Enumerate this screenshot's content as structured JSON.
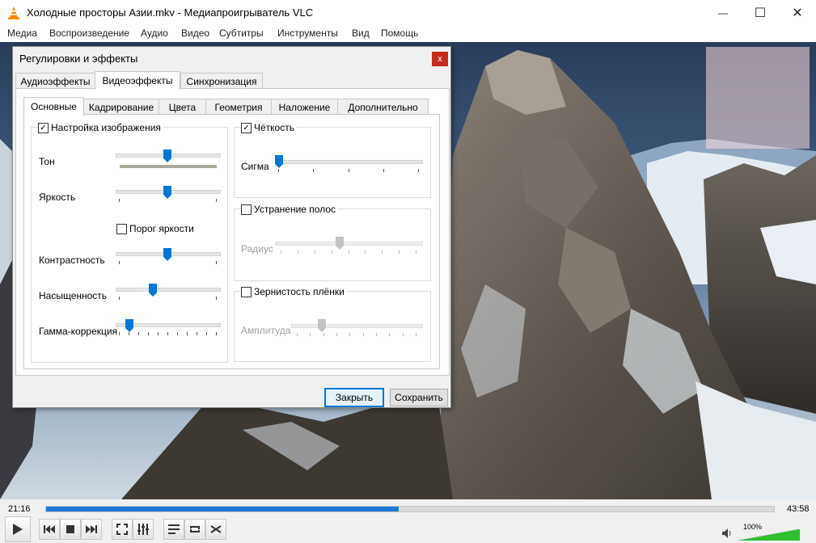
{
  "window": {
    "title": "Холодные просторы Азии.mkv - Медиапроигрыватель VLC",
    "minimize_glyph": "—",
    "maximize_glyph": "☐",
    "close_glyph": "✕"
  },
  "menu": [
    "Медиа",
    "Воспроизведение",
    "Аудио",
    "Видео",
    "Субтитры",
    "Инструменты",
    "Вид",
    "Помощь"
  ],
  "dialog": {
    "title": "Регулировки и эффекты",
    "close_glyph": "x",
    "tabs": [
      "Аудиоэффекты",
      "Видеоэффекты",
      "Синхронизация"
    ],
    "active_tab": "Видеоэффекты",
    "subtabs": [
      "Основные",
      "Кадрирование",
      "Цвета",
      "Геометрия",
      "Наложение",
      "Дополнительно"
    ],
    "active_subtab": "Основные",
    "image_adjust": {
      "label": "Настройка изображения",
      "checked": true,
      "hue_label": "Тон",
      "brightness_label": "Яркость",
      "brightness_threshold_label": "Порог яркости",
      "brightness_threshold_checked": false,
      "contrast_label": "Контрастность",
      "saturation_label": "Насыщенность",
      "gamma_label": "Гамма-коррекция",
      "hue_value": 0.5,
      "brightness_value": 0.5,
      "contrast_value": 0.5,
      "saturation_value": 0.35,
      "gamma_value": 0.1
    },
    "sharpen": {
      "label": "Чёткость",
      "checked": true,
      "sigma_label": "Сигма",
      "sigma_value": 0.0
    },
    "deband": {
      "label": "Устранение полос",
      "checked": false,
      "radius_label": "Радиус",
      "radius_value": 0.44
    },
    "grain": {
      "label": "Зернистость плёнки",
      "checked": false,
      "amplitude_label": "Амплитуда",
      "amplitude_value": 0.22
    },
    "close_button": "Закрыть",
    "save_button": "Сохранить"
  },
  "player": {
    "time_elapsed": "21:16",
    "time_total": "43:58",
    "progress": 0.484,
    "volume_label": "100%",
    "volume": 1.0
  },
  "colors": {
    "accent": "#0078d7",
    "seek_fill": "#1e79d6",
    "volume_green": "#2ec02e",
    "close_red": "#c42b1c"
  }
}
